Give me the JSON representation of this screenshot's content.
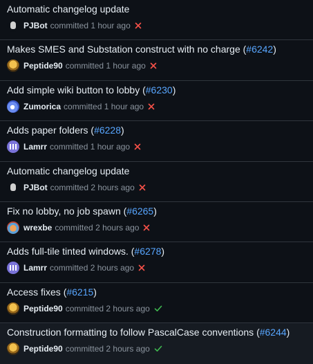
{
  "colors": {
    "link": "#58a6ff",
    "fail": "#f85149",
    "success": "#3fb950"
  },
  "commits": [
    {
      "title": "Automatic changelog update",
      "pr": "",
      "suffix": "",
      "author": "PJBot",
      "verb": "committed",
      "time": "1 hour ago",
      "status": "failure",
      "avatar": "pjbot"
    },
    {
      "title": "Makes SMES and Substation construct with no charge (",
      "pr": "#6242",
      "suffix": ")",
      "author": "Peptide90",
      "verb": "committed",
      "time": "1 hour ago",
      "status": "failure",
      "avatar": "peptide"
    },
    {
      "title": "Add simple wiki button to lobby (",
      "pr": "#6230",
      "suffix": ")",
      "author": "Zumorica",
      "verb": "committed",
      "time": "1 hour ago",
      "status": "failure",
      "avatar": "zumorica"
    },
    {
      "title": "Adds paper folders (",
      "pr": "#6228",
      "suffix": ")",
      "author": "Lamrr",
      "verb": "committed",
      "time": "1 hour ago",
      "status": "failure",
      "avatar": "lamrr"
    },
    {
      "title": "Automatic changelog update",
      "pr": "",
      "suffix": "",
      "author": "PJBot",
      "verb": "committed",
      "time": "2 hours ago",
      "status": "failure",
      "avatar": "pjbot"
    },
    {
      "title": "Fix no lobby, no job spawn (",
      "pr": "#6265",
      "suffix": ")",
      "author": "wrexbe",
      "verb": "committed",
      "time": "2 hours ago",
      "status": "failure",
      "avatar": "wrexbe"
    },
    {
      "title": "Adds full-tile tinted windows. (",
      "pr": "#6278",
      "suffix": ")",
      "author": "Lamrr",
      "verb": "committed",
      "time": "2 hours ago",
      "status": "failure",
      "avatar": "lamrr"
    },
    {
      "title": "Access fixes (",
      "pr": "#6215",
      "suffix": ")",
      "author": "Peptide90",
      "verb": "committed",
      "time": "2 hours ago",
      "status": "success",
      "avatar": "peptide"
    },
    {
      "title": "Construction formatting to follow PascalCase conventions (",
      "pr": "#6244",
      "suffix": ")",
      "author": "Peptide90",
      "verb": "committed",
      "time": "2 hours ago",
      "status": "success",
      "avatar": "peptide"
    }
  ]
}
